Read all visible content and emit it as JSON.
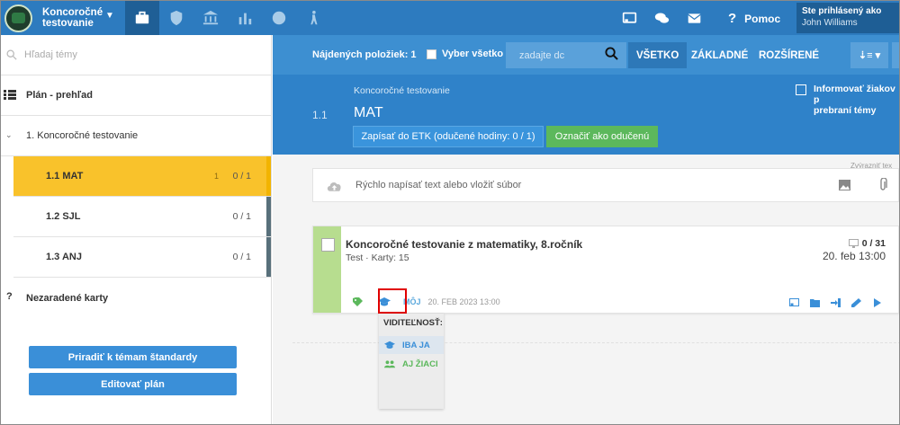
{
  "header": {
    "app_title_line1": "Koncoročné",
    "app_title_line2": "testovanie",
    "help_label": "Pomoc",
    "user_caption": "Ste prihlásený ako",
    "user_name": "John Williams",
    "nav_icons": [
      "briefcase-icon",
      "shield-icon",
      "bank-icon",
      "bar-chart-icon",
      "star-badge-icon",
      "hiking-icon"
    ],
    "right_icons": [
      "cast-icon",
      "chat-icon",
      "mail-icon"
    ]
  },
  "sidebar": {
    "search_placeholder": "Hľadaj témy",
    "plan_label": "Plán - prehľad",
    "topic_label": "1. Koncoročné testovanie",
    "items": [
      {
        "label": "1.1 MAT",
        "pending": "1",
        "count": "0 / 1",
        "active": true
      },
      {
        "label": "1.2 SJL",
        "pending": "",
        "count": "0 / 1",
        "active": false
      },
      {
        "label": "1.3 ANJ",
        "pending": "",
        "count": "0 / 1",
        "active": false
      }
    ],
    "unassigned_label": "Nezaradené karty",
    "assign_button": "Priradiť k témam štandardy",
    "edit_button": "Editovať plán"
  },
  "toolbar": {
    "found_label": "Nájdených položiek: 1",
    "select_all_label": "Vyber všetko",
    "search_placeholder": "zadajte dc",
    "filter_all": "VŠETKO",
    "filter_basic": "ZÁKLADNÉ",
    "filter_extended": "ROZŠÍRENÉ",
    "sort_icon": "sort-icon"
  },
  "topic": {
    "number": "1.1",
    "parent": "Koncoročné testovanie",
    "title": "MAT",
    "etk_button": "Zapísať do ETK (odučené hodiny: 0 / 1)",
    "done_button": "Označiť ako odučenú",
    "inform_line1": "Informovať žiakov p",
    "inform_line2": "prebraní témy"
  },
  "quick_add": {
    "placeholder": "Rýchlo napísať text alebo vložiť súbor",
    "cut_note": "Zvýrazniť tex"
  },
  "card": {
    "title": "Koncoročné testovanie z matematiky, 8.ročník",
    "subtitle": "Test · Karty: 15",
    "count": "0 / 31",
    "date": "20. feb 13:00",
    "visibility_label": "MÔJ",
    "created": "20. FEB 2023 13:00",
    "accent_color": "#b7dd8f"
  },
  "visibility_menu": {
    "heading": "VIDITEĽNOSŤ:",
    "option_me": "IBA JA",
    "option_students": "AJ ŽIACI"
  },
  "colors": {
    "header_bg": "#2d7bbf",
    "toolbar_bg": "#3d8fd1",
    "topic_bg": "#2f82c9",
    "active_item": "#f9c22b",
    "button_blue": "#3a8fd8",
    "button_green": "#5cb85c",
    "highlight_red": "#e00000"
  }
}
